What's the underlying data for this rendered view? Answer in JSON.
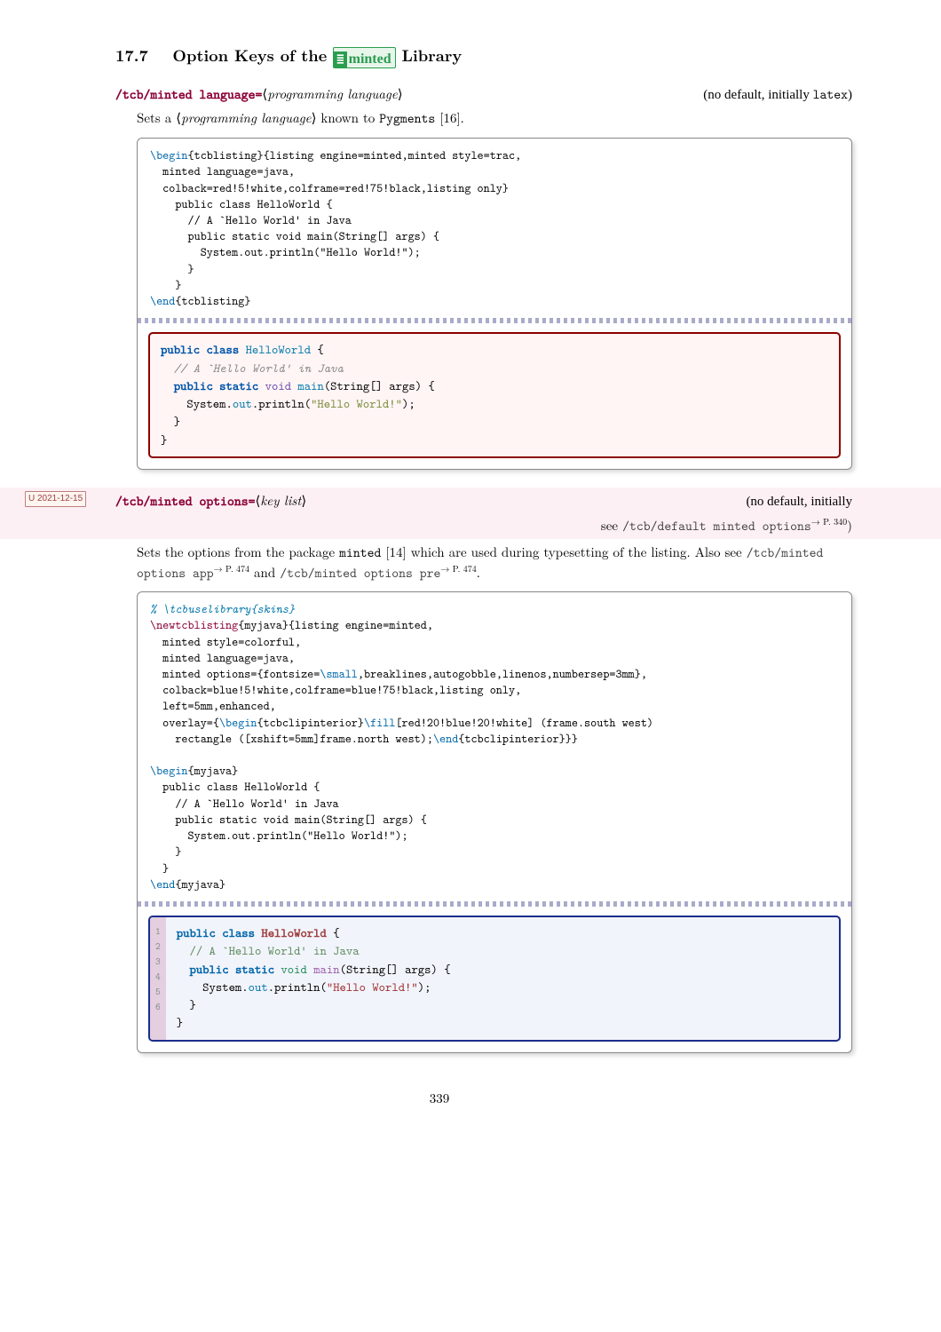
{
  "section": {
    "number": "17.7",
    "title_pre": "Option Keys of the ",
    "lib_eq": "≣",
    "lib_name": "minted",
    "title_post": " Library"
  },
  "key1": {
    "name": "/tcb/minted language",
    "eq": "=",
    "arg": "programming language",
    "default": "(no default, initially ",
    "default_tt": "latex",
    "default_end": ")",
    "desc_a": "Sets a ",
    "desc_arg": "programming language",
    "desc_b": " known to ",
    "desc_pyg": "Pygments",
    "desc_cite": " [16]."
  },
  "code1": {
    "l1a": "\\begin",
    "l1b": "{tcblisting}{listing engine=minted,minted style=trac,",
    "l2": "  minted language=java,",
    "l3": "  colback=red!5!white,colframe=red!75!black,listing only}",
    "l4": "    public class HelloWorld {",
    "l5": "      // A `Hello World' in Java",
    "l6": "      public static void main(String[] args) {",
    "l7": "        System.out.println(\"Hello World!\");",
    "l8": "      }",
    "l9": "    }",
    "l10a": "\\end",
    "l10b": "{tcblisting}"
  },
  "out1": {
    "kw_public": "public",
    "kw_class": "class",
    "cls": "HelloWorld",
    "ob": " {",
    "comment": "  // A `Hello World' in Java",
    "kw_static": "static",
    "void": "void",
    "main": "main",
    "sig": "(String[] args) {",
    "sysout_a": "    System.",
    "sysout_out": "out",
    "sysout_b": ".println(",
    "str": "\"Hello World!\"",
    "sysout_c": ");",
    "cb1": "  }",
    "cb2": "}"
  },
  "key2": {
    "badge": "U 2021-12-15",
    "name": "/tcb/minted options",
    "eq": "=",
    "arg": "key list",
    "default1": "(no default, initially",
    "default2a": "see ",
    "default2b": "/tcb/default minted options",
    "default2c": "→ P. 340",
    "default2d": ")",
    "desc_a": "Sets the options from the package ",
    "desc_pkg": "minted",
    "desc_b": " [14] which are used during typesetting of the listing. Also see ",
    "ref1": "/tcb/minted options app",
    "ref1p": "→ P. 474",
    "desc_c": " and ",
    "ref2": "/tcb/minted options pre",
    "ref2p": "→ P. 474",
    "desc_d": "."
  },
  "code2": {
    "l1": "% \\tcbuselibrary{skins}",
    "l2a": "\\newtcblisting",
    "l2b": "{myjava}{listing engine=minted,",
    "l3": "  minted style=colorful,",
    "l4": "  minted language=java,",
    "l5a": "  minted options={fontsize=",
    "l5b": "\\small",
    "l5c": ",breaklines,autogobble,linenos,numbersep=3mm},",
    "l6": "  colback=blue!5!white,colframe=blue!75!black,listing only,",
    "l7": "  left=5mm,enhanced,",
    "l8a": "  overlay={",
    "l8b": "\\begin",
    "l8c": "{tcbclipinterior}",
    "l8d": "\\fill",
    "l8e": "[red!20!blue!20!white] (frame.south west)",
    "l9a": "    rectangle ([xshift=5mm]frame.north west);",
    "l9b": "\\end",
    "l9c": "{tcbclipinterior}}}",
    "l11a": "\\begin",
    "l11b": "{myjava}",
    "l12": "  public class HelloWorld {",
    "l13": "    // A `Hello World' in Java",
    "l14": "    public static void main(String[] args) {",
    "l15": "      System.out.println(\"Hello World!\");",
    "l16": "    }",
    "l17": "  }",
    "l18a": "\\end",
    "l18b": "{myjava}"
  },
  "out2": {
    "n1": "1",
    "n2": "2",
    "n3": "3",
    "n4": "4",
    "n5": "5",
    "n6": "6",
    "kw_public": "public",
    "kw_class": "class",
    "cls": "HelloWorld",
    "ob": " {",
    "comment": "// A `Hello World' in Java",
    "kw_static": "static",
    "void": "void",
    "main": "main",
    "sig": "(String[] args) {",
    "sys_a": "    System.",
    "sys_out": "out",
    "sys_b": ".println(",
    "str": "\"Hello World!\"",
    "sys_c": ");",
    "cb1": "  }",
    "cb2": "}"
  },
  "page": "339"
}
